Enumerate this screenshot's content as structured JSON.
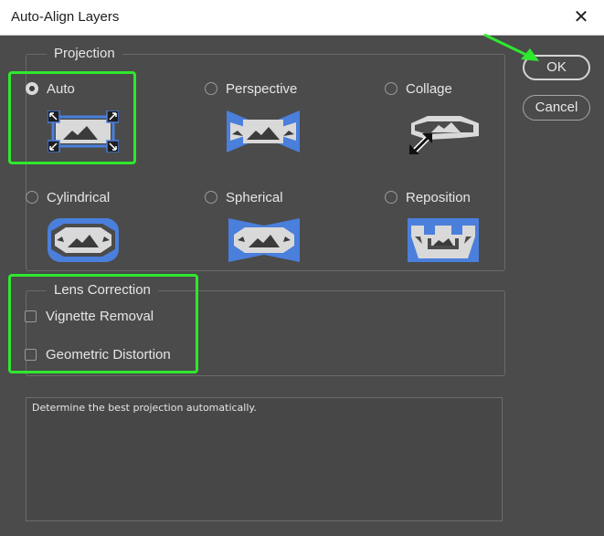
{
  "window": {
    "title": "Auto-Align Layers",
    "close_glyph": "✕"
  },
  "projection": {
    "legend": "Projection",
    "options": [
      {
        "label": "Auto",
        "checked": true,
        "icon": "auto-projection-icon"
      },
      {
        "label": "Perspective",
        "checked": false,
        "icon": "perspective-projection-icon"
      },
      {
        "label": "Collage",
        "checked": false,
        "icon": "collage-projection-icon"
      },
      {
        "label": "Cylindrical",
        "checked": false,
        "icon": "cylindrical-projection-icon"
      },
      {
        "label": "Spherical",
        "checked": false,
        "icon": "spherical-projection-icon"
      },
      {
        "label": "Reposition",
        "checked": false,
        "icon": "reposition-projection-icon"
      }
    ]
  },
  "lens_correction": {
    "legend": "Lens Correction",
    "options": [
      {
        "label": "Vignette Removal",
        "checked": false
      },
      {
        "label": "Geometric Distortion",
        "checked": false
      }
    ]
  },
  "description": "Determine the best projection automatically.",
  "buttons": {
    "ok": "OK",
    "cancel": "Cancel"
  },
  "colors": {
    "dialog_bg": "#4b4b4b",
    "icon_blue": "#4a7fdc",
    "icon_gray": "#d9d9d9",
    "highlight_green": "#2ee82e"
  }
}
